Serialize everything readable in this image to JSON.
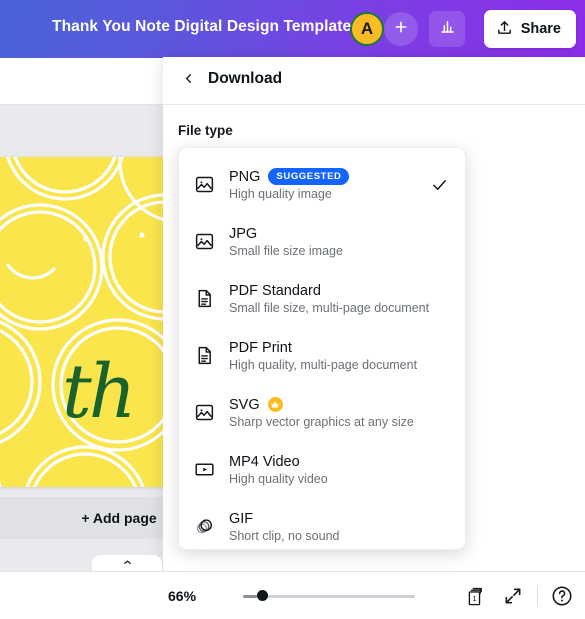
{
  "header": {
    "doc_title": "Thank You Note Digital Design Template",
    "avatar_initial": "A",
    "add_collaborator_icon": "plus-icon",
    "analytics_icon": "bar-chart-icon",
    "share_label": "Share",
    "share_icon": "upload-icon",
    "gradient_from": "#4a63d8",
    "gradient_to": "#8c2ee9"
  },
  "canvas": {
    "page_text": "th",
    "page_bg_color": "#fae54d",
    "page_text_color": "#19622c",
    "add_page_label": "+ Add page"
  },
  "side_panel": {
    "quantity_value": "1",
    "chevron_icon": "chevron-down-icon",
    "crown_icon": "crown-icon",
    "cta_color": "#8b3dfc"
  },
  "download_panel": {
    "back_icon": "chevron-left-icon",
    "title": "Download",
    "section_label": "File type",
    "selected_index": 0,
    "check_icon": "check-icon",
    "badge_color": "#1464ff",
    "crown_color": "#fcbc1f",
    "file_types": [
      {
        "name": "PNG",
        "description": "High quality image",
        "icon": "image-icon",
        "badge": "SUGGESTED",
        "pro": false,
        "selected": true
      },
      {
        "name": "JPG",
        "description": "Small file size image",
        "icon": "image-icon",
        "badge": "",
        "pro": false,
        "selected": false
      },
      {
        "name": "PDF Standard",
        "description": "Small file size, multi-page document",
        "icon": "document-icon",
        "badge": "",
        "pro": false,
        "selected": false
      },
      {
        "name": "PDF Print",
        "description": "High quality, multi-page document",
        "icon": "document-icon",
        "badge": "",
        "pro": false,
        "selected": false
      },
      {
        "name": "SVG",
        "description": "Sharp vector graphics at any size",
        "icon": "image-icon",
        "badge": "",
        "pro": true,
        "selected": false
      },
      {
        "name": "MP4 Video",
        "description": "High quality video",
        "icon": "video-icon",
        "badge": "",
        "pro": false,
        "selected": false
      },
      {
        "name": "GIF",
        "description": "Short clip, no sound",
        "icon": "gif-icon",
        "badge": "",
        "pro": false,
        "selected": false
      }
    ]
  },
  "bottom_bar": {
    "collapse_icon": "chevron-up-icon",
    "zoom_level": "66%",
    "zoom_slider_percent": 8,
    "page_count": "1",
    "pages_icon": "pages-icon",
    "expand_icon": "expand-icon",
    "help_icon": "question-circle-icon"
  }
}
